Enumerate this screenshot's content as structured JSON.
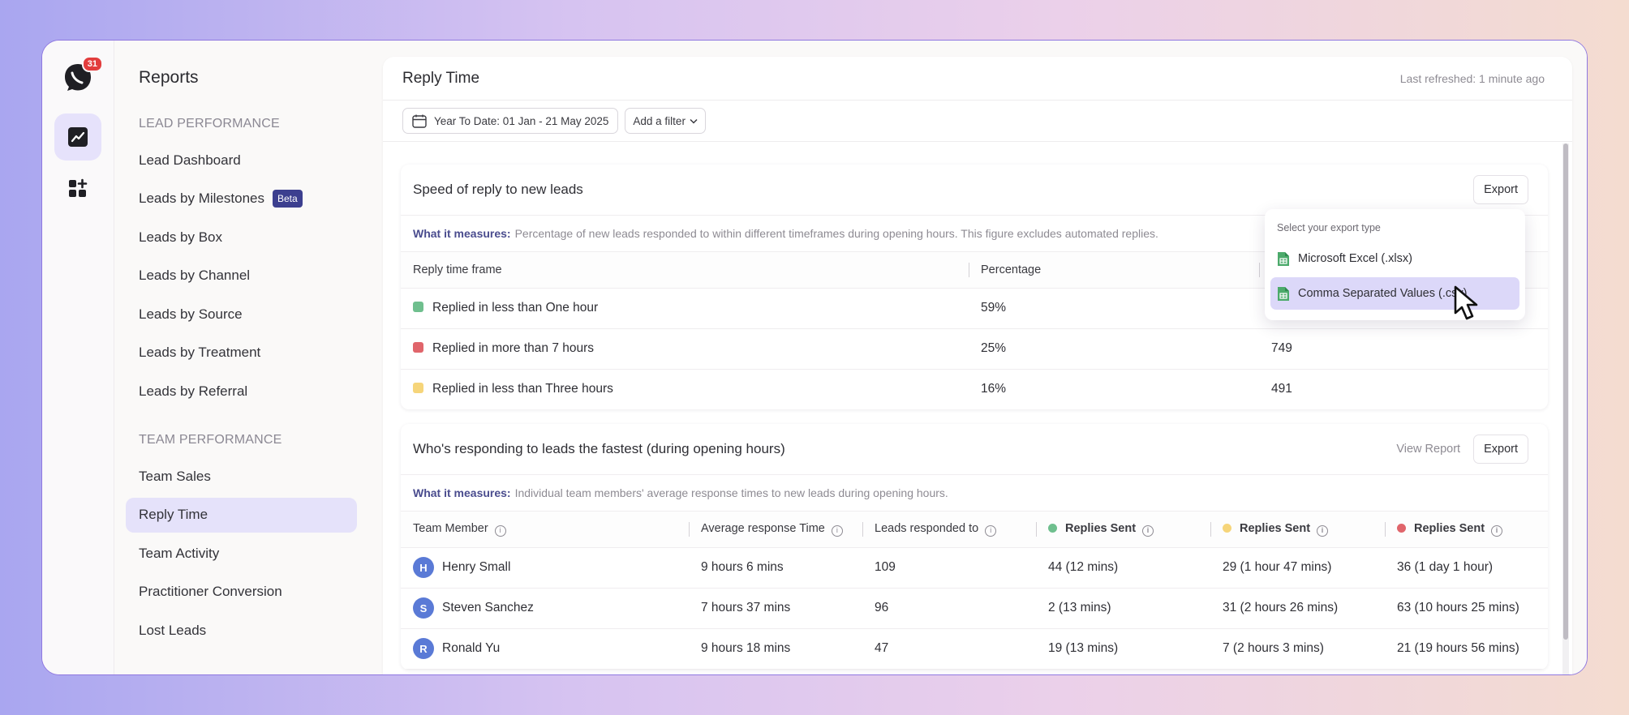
{
  "rail": {
    "badge_count": "31"
  },
  "nav": {
    "title": "Reports",
    "section_lead": "Lead Performance",
    "lead_items": [
      "Lead Dashboard",
      "Leads by Milestones",
      "Leads by Box",
      "Leads by Channel",
      "Leads by Source",
      "Leads by Treatment",
      "Leads by Referral"
    ],
    "beta_label": "Beta",
    "section_team": "Team Performance",
    "team_items": [
      "Team Sales",
      "Reply Time",
      "Team Activity",
      "Practitioner Conversion",
      "Lost Leads"
    ],
    "active_item": "Reply Time"
  },
  "header": {
    "title": "Reply Time",
    "refreshed": "Last refreshed: 1 minute ago"
  },
  "filters": {
    "date_range": "Year To Date: 01 Jan - 21 May 2025",
    "add_filter": "Add a filter"
  },
  "speed_card": {
    "title": "Speed of reply to new leads",
    "export_label": "Export",
    "measures_label": "What it measures:",
    "measures_text": "Percentage of new leads responded to within different timeframes during opening hours. This figure excludes automated replies.",
    "columns": [
      "Reply time frame",
      "Percentage",
      ""
    ],
    "rows": [
      {
        "color": "#6fbf8e",
        "label": "Replied in less than One hour",
        "percentage": "59%",
        "count": ""
      },
      {
        "color": "#e0656b",
        "label": "Replied in more than 7 hours",
        "percentage": "25%",
        "count": "749"
      },
      {
        "color": "#f6d57a",
        "label": "Replied in less than Three hours",
        "percentage": "16%",
        "count": "491"
      }
    ]
  },
  "export_menu": {
    "label": "Select your export type",
    "options": [
      "Microsoft Excel (.xlsx)",
      "Comma Separated Values (.csv)"
    ],
    "hovered": "Comma Separated Values (.csv)"
  },
  "team_card": {
    "title": "Who's responding to leads the fastest (during opening hours)",
    "view_report_label": "View Report",
    "export_label": "Export",
    "measures_label": "What it measures:",
    "measures_text": "Individual team members' average response times to new leads during opening hours.",
    "columns": [
      "Team Member",
      "Average response Time",
      "Leads responded to",
      "Replies Sent",
      "Replies Sent",
      "Replies Sent"
    ],
    "column_dot_colors": [
      "#6fbf8e",
      "#f6d57a",
      "#e0656b"
    ],
    "rows": [
      {
        "initial": "H",
        "name": "Henry Small",
        "avg": "9 hours 6 mins",
        "leads": "109",
        "green": "44 (12 mins)",
        "yellow": "29 (1 hour 47 mins)",
        "red": "36 (1 day 1 hour)"
      },
      {
        "initial": "S",
        "name": "Steven Sanchez",
        "avg": "7 hours 37 mins",
        "leads": "96",
        "green": "2 (13 mins)",
        "yellow": "31 (2 hours 26 mins)",
        "red": "63 (10 hours 25 mins)"
      },
      {
        "initial": "R",
        "name": "Ronald Yu",
        "avg": "9 hours 18 mins",
        "leads": "47",
        "green": "19 (13 mins)",
        "yellow": "7 (2 hours 3 mins)",
        "red": "21 (19 hours 56 mins)"
      }
    ]
  }
}
